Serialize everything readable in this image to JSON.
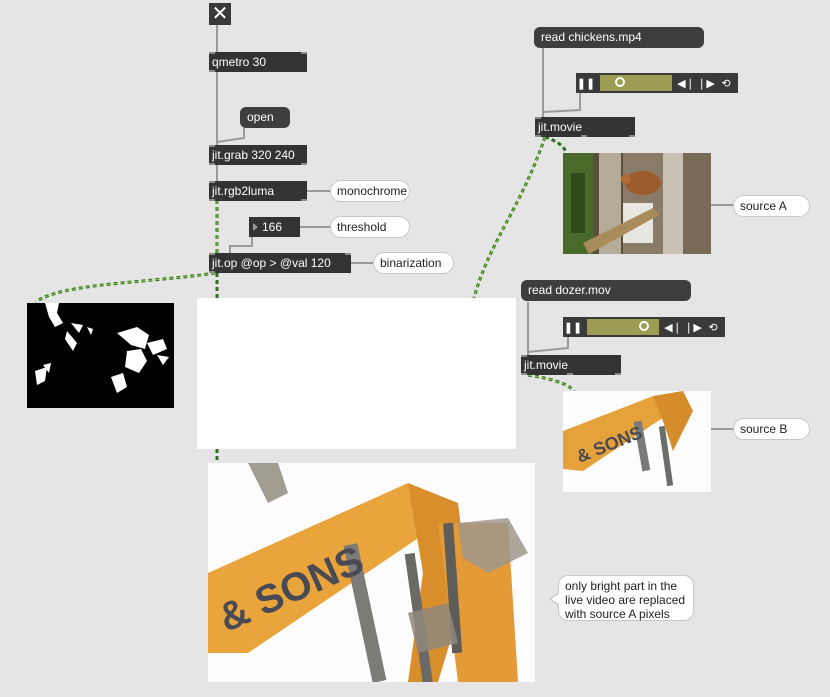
{
  "objects": {
    "qmetro": "qmetro 30",
    "open": "open",
    "grab": "jit.grab 320 240",
    "rgb2luma": "jit.rgb2luma",
    "threshold_value": "166",
    "jitop": "jit.op @op > @val 120",
    "read_chickens": "read chickens.mp4",
    "movie_a": "jit.movie",
    "read_dozer": "read dozer.mov",
    "movie_b": "jit.movie"
  },
  "comments": {
    "monochrome": "monochrome",
    "threshold": "threshold",
    "binarization": "binarization",
    "source_a": "source A",
    "source_b": "source B",
    "note": "only bright part in the live video are replaced with source A pixels"
  },
  "transport_a": {
    "position": 0.24
  },
  "transport_b": {
    "position": 0.84
  },
  "colors": {
    "cord": "#6fa13a",
    "box": "#333333",
    "comment_bg": "#ffffff"
  }
}
